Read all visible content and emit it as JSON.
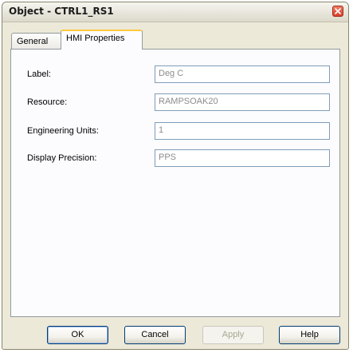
{
  "window": {
    "title": "Object - CTRL1_RS1"
  },
  "tabs": [
    {
      "label": "General",
      "active": false
    },
    {
      "label": "HMI Properties",
      "active": true
    }
  ],
  "fields": [
    {
      "label": "Label:",
      "value": "Deg C"
    },
    {
      "label": "Resource:",
      "value": "RAMPSOAK20"
    },
    {
      "label": "Engineering Units:",
      "value": "1"
    },
    {
      "label": "Display Precision:",
      "value": "PPS"
    }
  ],
  "buttons": {
    "ok": "OK",
    "cancel": "Cancel",
    "apply": "Apply",
    "help": "Help"
  },
  "colors": {
    "dialog_bg": "#ECE9D8",
    "active_tab_accent": "#FFC83C",
    "close_button": "#D9402A"
  }
}
